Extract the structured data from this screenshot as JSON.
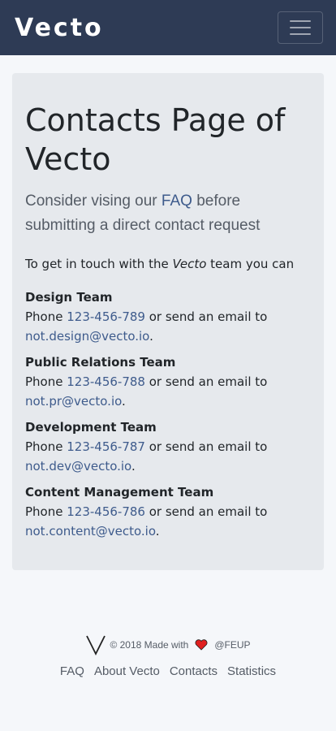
{
  "navbar": {
    "brand": "Vecto",
    "toggle_icon": "hamburger-menu-icon"
  },
  "main": {
    "title": "Contacts Page of Vecto",
    "lead_before": "Consider vising our ",
    "lead_link": "FAQ",
    "lead_after": " before submitting a direct contact request",
    "intro_before": "To get in touch with the ",
    "intro_em": "Vecto",
    "intro_after": " team you can",
    "phone_prefix": "Phone ",
    "email_mid": " or send an email to",
    "period": ".",
    "teams": [
      {
        "name": "Design Team",
        "phone": "123-456-789",
        "email": "not.design@vecto.io"
      },
      {
        "name": "Public Relations Team",
        "phone": "123-456-788",
        "email": "not.pr@vecto.io"
      },
      {
        "name": "Development Team",
        "phone": "123-456-787",
        "email": "not.dev@vecto.io"
      },
      {
        "name": "Content Management Team",
        "phone": "123-456-786",
        "email": "not.content@vecto.io"
      }
    ]
  },
  "footer": {
    "logo_icon": "vecto-v-logo-icon",
    "copyright": "© 2018 Made with",
    "heart_icon": "heart-icon",
    "org": "@FEUP",
    "links": [
      "FAQ",
      "About Vecto",
      "Contacts",
      "Statistics"
    ]
  },
  "colors": {
    "navbar": "#2e3b55",
    "link": "#3e5b8c",
    "jumbotron": "#e6e9ed",
    "heart": "#e02020"
  }
}
